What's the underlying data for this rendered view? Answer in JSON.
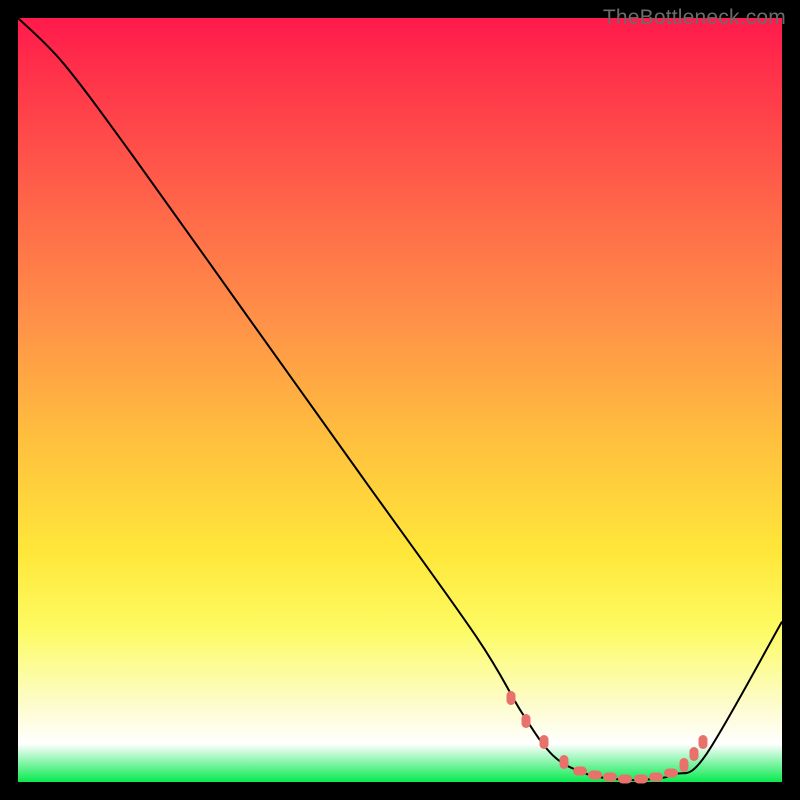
{
  "watermark": "TheBottleneck.com",
  "chart_data": {
    "type": "line",
    "title": "",
    "xlabel": "",
    "ylabel": "",
    "xlim": [
      0,
      100
    ],
    "ylim": [
      0,
      100
    ],
    "grid": false,
    "series": [
      {
        "name": "curve",
        "x": [
          0,
          6,
          15,
          30,
          45,
          60,
          66,
          70,
          74,
          78,
          82,
          86,
          90,
          100
        ],
        "y": [
          100,
          94,
          82,
          61,
          40,
          19,
          9,
          3.5,
          1.2,
          0.4,
          0.3,
          1.0,
          3.5,
          21
        ]
      }
    ],
    "markers": {
      "name": "highlight",
      "x": [
        64.5,
        66.5,
        68.8,
        71.5,
        73.5,
        75.5,
        77.5,
        79.5,
        81.5,
        83.5,
        85.5,
        87.2,
        88.5,
        89.7
      ],
      "y": [
        11.0,
        8.0,
        5.2,
        2.6,
        1.4,
        0.9,
        0.6,
        0.4,
        0.4,
        0.6,
        1.2,
        2.2,
        3.6,
        5.3
      ]
    },
    "gradient_bg": true
  }
}
